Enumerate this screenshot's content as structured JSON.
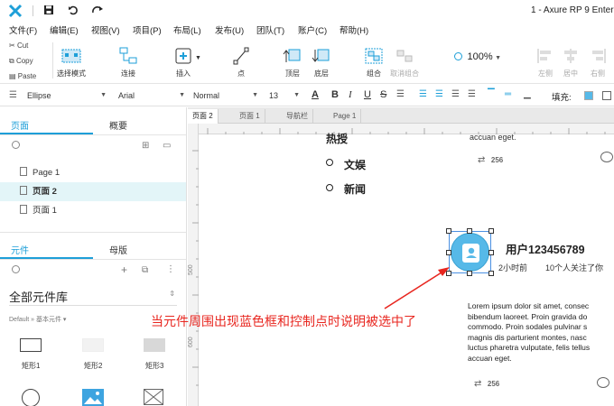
{
  "app": {
    "title": "1 - Axure RP 9 Enterp"
  },
  "menu": [
    "文件(F)",
    "编辑(E)",
    "视图(V)",
    "项目(P)",
    "布局(L)",
    "发布(U)",
    "团队(T)",
    "账户(C)",
    "帮助(H)"
  ],
  "clipboard": {
    "cut": "Cut",
    "copy": "Copy",
    "paste": "Paste"
  },
  "tools": {
    "select_mode": "选择模式",
    "connect": "连接",
    "insert": "插入",
    "point": "点",
    "top_layer": "顶层",
    "bottom_layer": "底层",
    "group": "组合",
    "ungroup": "取消组合",
    "zoom": "100%",
    "align_left": "左侧",
    "align_center": "居中",
    "align_right": "右侧"
  },
  "format": {
    "shape": "Ellipse",
    "font": "Arial",
    "style": "Normal",
    "size": "13",
    "fill_label": "填充:"
  },
  "left_panel": {
    "pages_tab": "页面",
    "outline_tab": "概要",
    "pages": [
      "Page 1",
      "页面 2",
      "页面 1"
    ],
    "widgets_tab": "元件",
    "masters_tab": "母版",
    "library_name": "全部元件库",
    "breadcrumb": "Default » 基本元件 ▾",
    "widgets": [
      "矩形1",
      "矩形2",
      "矩形3"
    ]
  },
  "doc_tabs": [
    "页面 2",
    "页面 1",
    "导航栏",
    "Page 1"
  ],
  "rulers": {
    "v": [
      "500",
      "600",
      "700"
    ]
  },
  "canvas": {
    "top_text": "热授",
    "top_eget": "accuan eget.",
    "retweet_count_1": "256",
    "list": [
      "文娱",
      "新闻"
    ],
    "user_name": "用户123456789",
    "time": "2小时前",
    "followers": "10个人关注了你",
    "lorem": [
      "Lorem ipsum dolor sit amet, consec",
      "bibendum laoreet. Proin gravida do",
      "commodo. Proin sodales pulvinar s",
      "magnis dis parturient montes, nasc",
      "luctus pharetra vulputate, felis tellus",
      "accuan eget."
    ],
    "retweet_count_2": "256",
    "annotation": "当元件周围出现蓝色框和控制点时说明被选中了"
  },
  "colors": {
    "accent": "#1e9fd8",
    "annotation": "#e8261f",
    "selection": "#56b9e8"
  }
}
